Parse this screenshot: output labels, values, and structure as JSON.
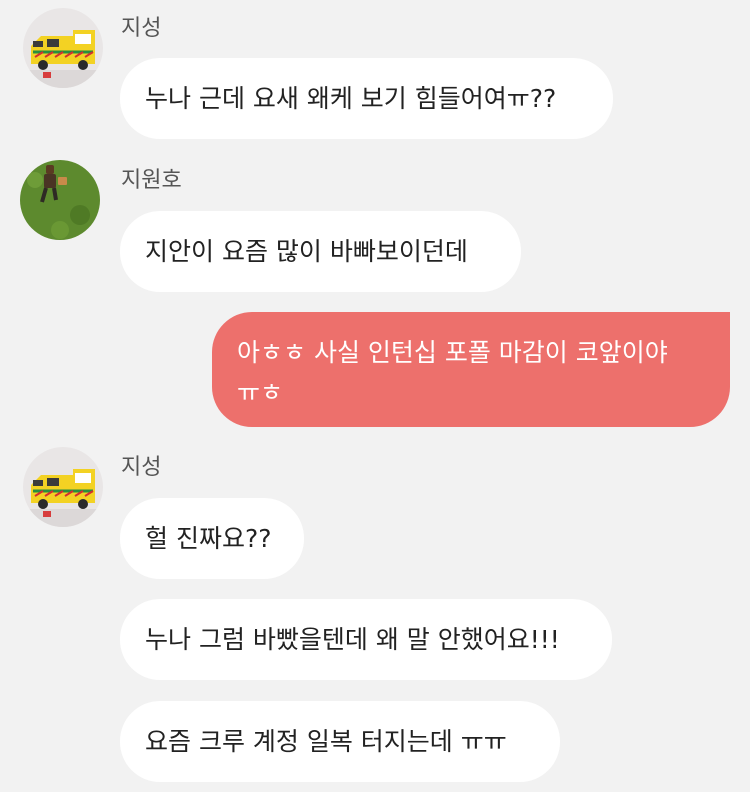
{
  "messages": [
    {
      "sender": "지성",
      "texts": [
        "누나 근데 요새 왜케 보기 힘들어여ㅠ??"
      ]
    },
    {
      "sender": "지원호",
      "texts": [
        "지안이 요즘 많이 바빠보이던데"
      ]
    },
    {
      "sender": "me",
      "texts": [
        "아ㅎㅎ 사실 인턴십 포폴 마감이 코앞이야",
        "ㅠㅎ"
      ]
    },
    {
      "sender": "지성",
      "texts": [
        "헐 진짜요??",
        "누나 그럼 바빴을텐데 왜 말 안했어요!!!",
        "요즘 크루 계정 일복 터지는데 ㅠㅠ"
      ]
    }
  ],
  "avatars": {
    "jiseong": "ambulance-avatar-icon",
    "jiwonho": "grass-figure-avatar-icon"
  },
  "colors": {
    "background": "#f2f2f2",
    "incoming_bubble": "#ffffff",
    "outgoing_bubble": "#ed706c",
    "sender_name": "#555555"
  }
}
